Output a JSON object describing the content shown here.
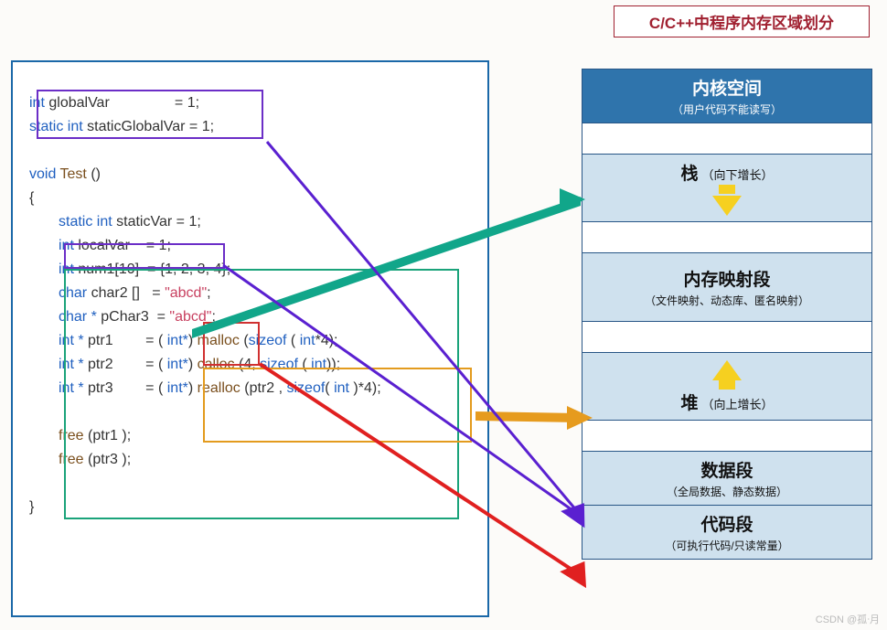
{
  "title": "C/C++中程序内存区域划分",
  "code": {
    "int": "int",
    "static_int": "static int",
    "void": "void",
    "char": "char",
    "charp": "char *",
    "intp": "int *",
    "intps": "int*",
    "globalVar": "globalVar",
    "staticGlobalVar": "staticGlobalVar",
    "Test": "Test",
    "staticVar": "staticVar",
    "localVar": "localVar",
    "num1": "num1[10]",
    "char2": "char2 []",
    "pChar3": "pChar3",
    "ptr1": "ptr1",
    "ptr2": "ptr2",
    "ptr3": "ptr3",
    "eq1": "= 1;",
    "arrlit": "= {1, 2, 3, 4};",
    "abcd": "\"abcd\"",
    "malloc": "malloc",
    "calloc": "calloc",
    "realloc": "realloc",
    "sizeof": "sizeof",
    "free": "free",
    "four_semi": "*4);",
    "lparen": "(",
    "rparen": ")",
    "paren_empty": "()",
    "comma4": "(4,",
    "star4rp": ")*4);",
    "ptr2_comma": "(ptr2 ,",
    "rp_semi": ");",
    "eq": "=",
    "semi": ";",
    "lbrace": "{",
    "rbrace": "}"
  },
  "memory": {
    "kernel": {
      "title": "内核空间",
      "sub": "（用户代码不能读写）"
    },
    "stack": {
      "title": "栈",
      "note": "（向下增长）"
    },
    "mmap": {
      "title": "内存映射段",
      "sub": "（文件映射、动态库、匿名映射）"
    },
    "heap": {
      "title": "堆",
      "note": "（向上增长）"
    },
    "data": {
      "title": "数据段",
      "sub": "（全局数据、静态数据）"
    },
    "text": {
      "title": "代码段",
      "sub": "（可执行代码/只读常量）"
    }
  },
  "watermark": "CSDN @孤ᐧ月"
}
